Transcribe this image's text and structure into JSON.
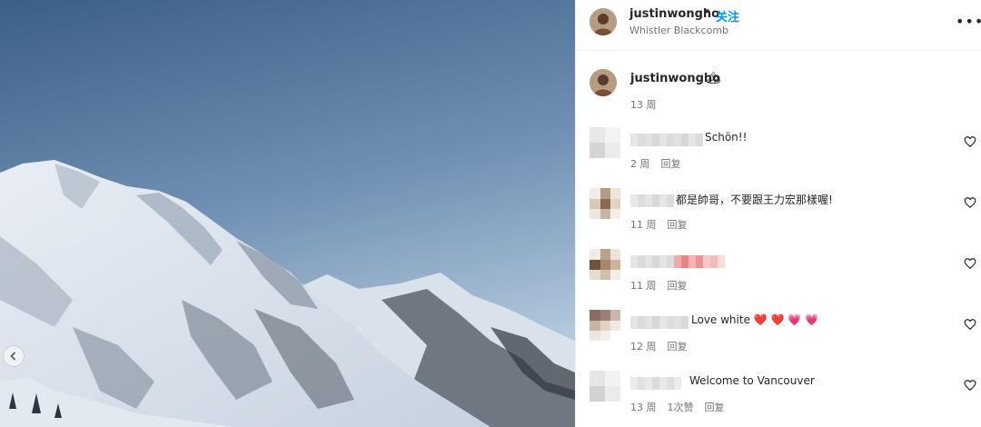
{
  "post": {
    "username": "justinwongho",
    "separator": "•",
    "follow_label": "关注",
    "location": "Whistler Blackcomb",
    "more_icon": "more-horizontal-icon",
    "caption": {
      "username": "justinwongho",
      "emoji": "🏔",
      "time": "13 周"
    }
  },
  "comments": [
    {
      "text": "Schön!!",
      "time": "2 周",
      "reply": "回复",
      "likes": ""
    },
    {
      "text": "都是帥哥，不要跟王力宏那樣喔!",
      "time": "11 周",
      "reply": "回复",
      "likes": ""
    },
    {
      "text": "",
      "time": "11 周",
      "reply": "回复",
      "likes": ""
    },
    {
      "text": "Love white",
      "hearts": "❤️ ❤️ 💗 💗",
      "time": "12 周",
      "reply": "回复",
      "likes": ""
    },
    {
      "text": "Welcome to Vancouver",
      "time": "13 周",
      "reply": "回复",
      "likes": "1次赞"
    }
  ],
  "colors": {
    "accent": "#0095f6",
    "meta": "#737373",
    "text": "#262626",
    "sky_top": "#3c5f86",
    "sky_bottom": "#aec4d8"
  }
}
